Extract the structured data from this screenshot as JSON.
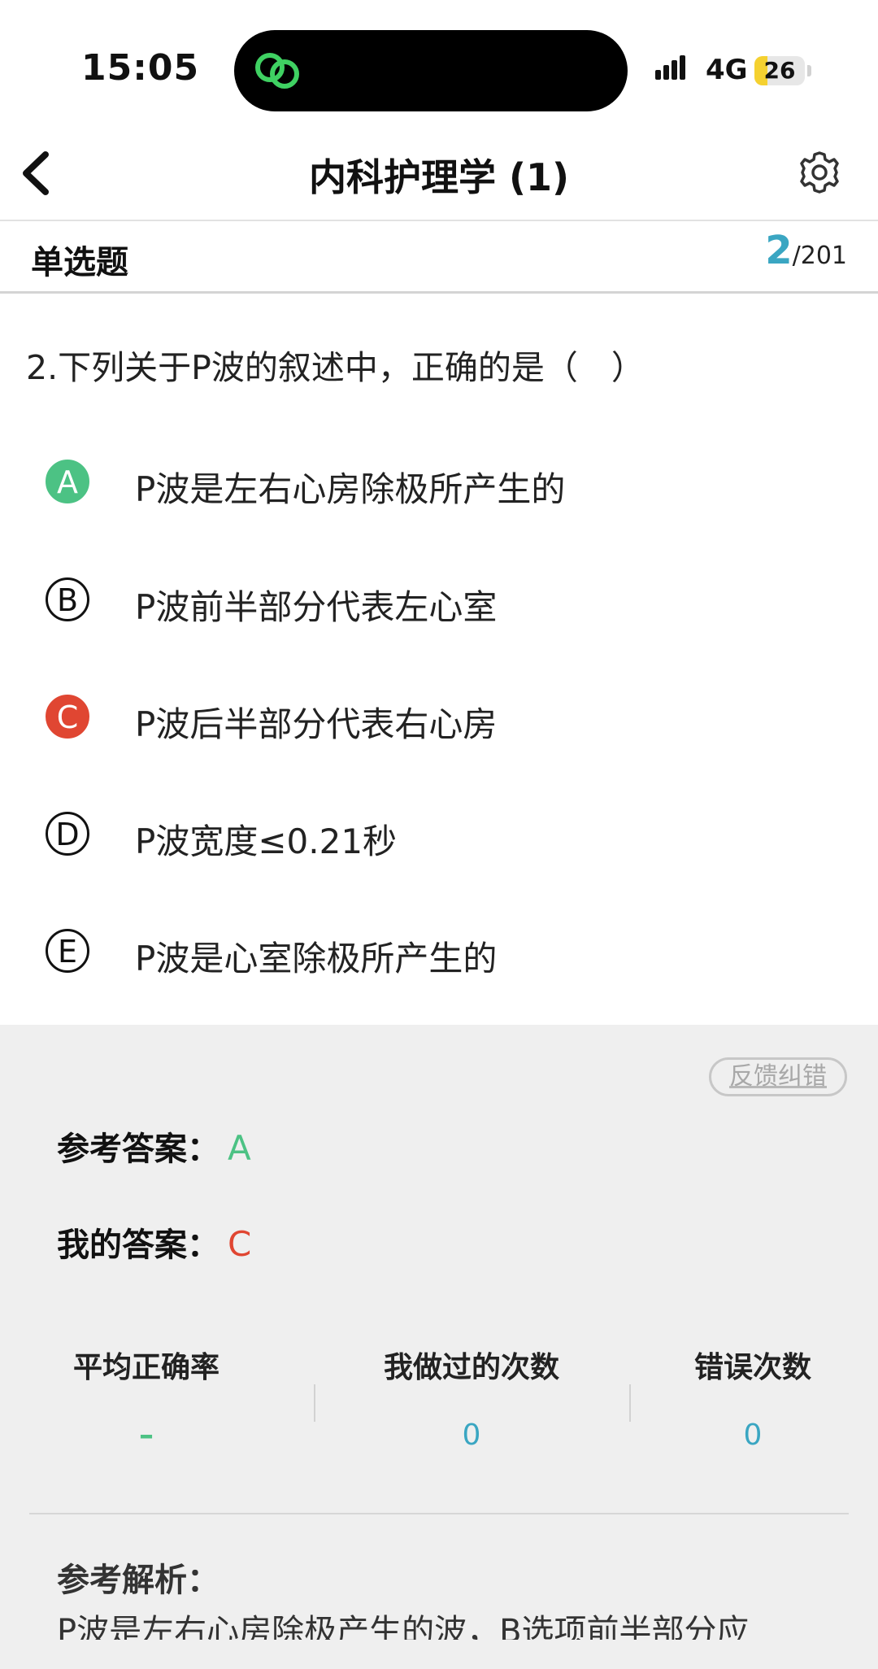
{
  "status_bar": {
    "time": "15:05",
    "network": "4G",
    "battery": "26",
    "battery_level": 0.26,
    "battery_color": "#f5d130"
  },
  "nav": {
    "back_icon": "chevron-left-icon",
    "title": "内科护理学 (1)",
    "settings_icon": "gear-icon"
  },
  "question_type": {
    "label": "单选题",
    "current": "2",
    "total": "/201"
  },
  "question": {
    "text": "2.下列关于P波的叙述中，正确的是（　）",
    "options": [
      {
        "letter": "A",
        "text": "P波是左右心房除极所产生的",
        "state": "correct"
      },
      {
        "letter": "B",
        "text": "P波前半部分代表左心室",
        "state": "none"
      },
      {
        "letter": "C",
        "text": "P波后半部分代表右心房",
        "state": "wrong"
      },
      {
        "letter": "D",
        "text": "P波宽度≤0.21秒",
        "state": "none"
      },
      {
        "letter": "E",
        "text": "P波是心室除极所产生的",
        "state": "none"
      }
    ]
  },
  "answer_panel": {
    "feedback_button": "反馈纠错",
    "reference_label": "参考答案：",
    "reference_value": "A",
    "my_label": "我的答案：",
    "my_value": "C",
    "stats": [
      {
        "label": "平均正确率",
        "value": "–"
      },
      {
        "label": "我做过的次数",
        "value": "0"
      },
      {
        "label": "错误次数",
        "value": "0"
      }
    ],
    "analysis_label": "参考解析：",
    "analysis_text": "P波是左右心房除极产生的波，B选项前半部分应"
  },
  "colors": {
    "accent": "#3aa6c2",
    "correct": "#4cc284",
    "wrong": "#e04632",
    "panel_bg": "#efefef"
  }
}
